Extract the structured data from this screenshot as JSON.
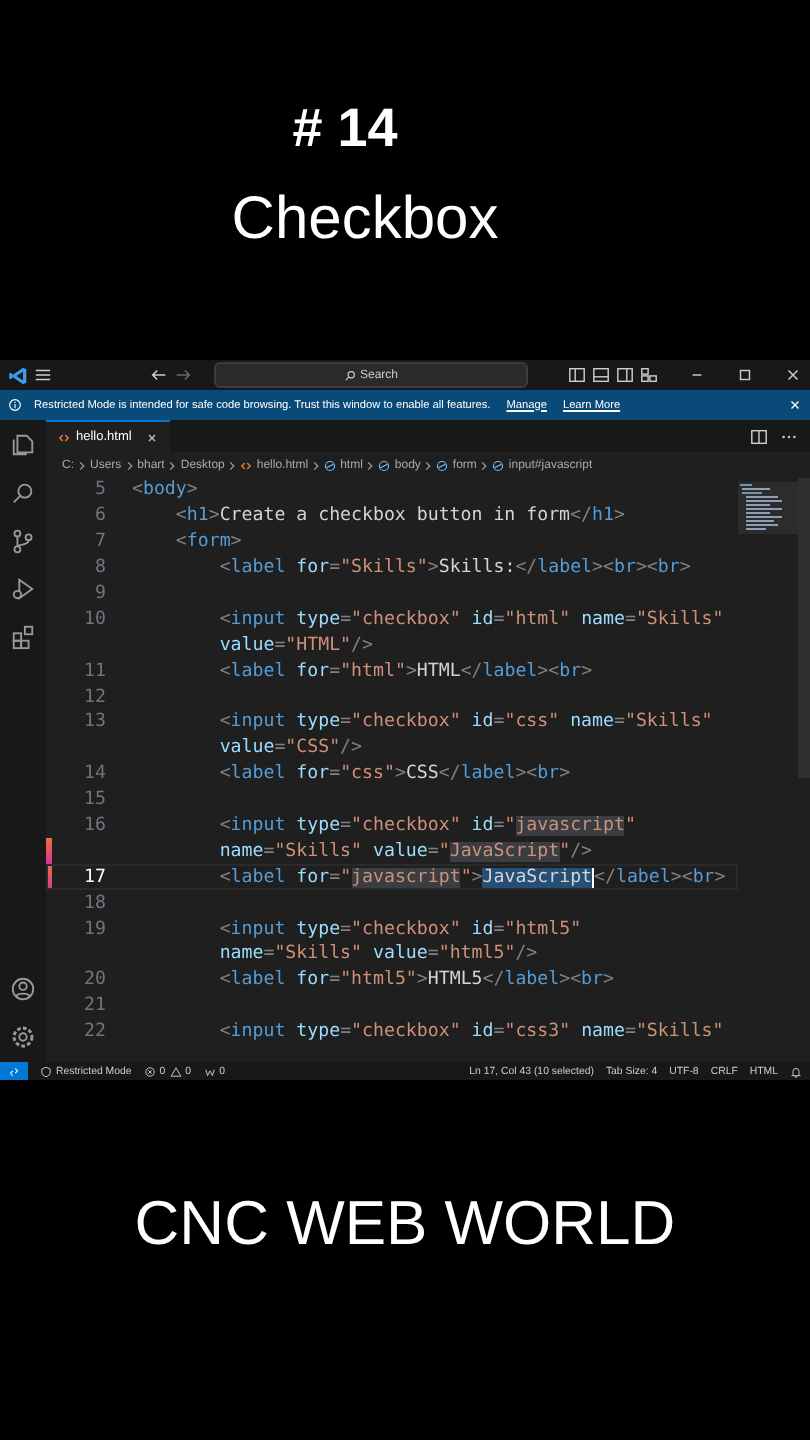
{
  "video_title": {
    "number": "# 14",
    "title": "Checkbox"
  },
  "titlebar": {
    "search": "Search"
  },
  "notification": {
    "text": "Restricted Mode is intended for safe code browsing. Trust this window to enable all features.",
    "links": [
      "Manage",
      "Learn More"
    ]
  },
  "tabs": [
    {
      "label": "hello.html",
      "selected": true
    }
  ],
  "breadcrumbs": [
    {
      "label": "C:",
      "kind": "folder"
    },
    {
      "label": "Users",
      "kind": "folder"
    },
    {
      "label": "bhart",
      "kind": "folder"
    },
    {
      "label": "Desktop",
      "kind": "folder"
    },
    {
      "label": "hello.html",
      "kind": "file"
    },
    {
      "label": "html",
      "kind": "symbol"
    },
    {
      "label": "body",
      "kind": "symbol"
    },
    {
      "label": "form",
      "kind": "symbol"
    },
    {
      "label": "input#javascript",
      "kind": "symbol"
    }
  ],
  "lines": [
    {
      "number": "5",
      "current": false,
      "modified": false,
      "parts": [
        {
          "text": "<body>"
        }
      ]
    },
    {
      "number": "6",
      "current": false,
      "modified": false,
      "parts": [
        {
          "text": "    <h1>Create a checkbox button in form</h1>"
        }
      ]
    },
    {
      "number": "7",
      "current": false,
      "modified": false,
      "parts": [
        {
          "text": "    <form>"
        }
      ]
    },
    {
      "number": "8",
      "current": false,
      "modified": false,
      "parts": [
        {
          "text": "        <label for=\"Skills\">Skills:</label><br><br>"
        }
      ]
    },
    {
      "number": "9",
      "current": false,
      "modified": false
    },
    {
      "number": "10",
      "current": false,
      "modified": false,
      "parts": [
        {
          "text": "        <input type=\"checkbox\" id=\"html\" name=\"Skills\""
        }
      ]
    },
    {
      "modified": false,
      "parts": [
        {
          "text": "        value=\"HTML\"/>"
        }
      ]
    },
    {
      "number": "11",
      "current": false,
      "modified": false,
      "parts": [
        {
          "text": "        <label for=\"html\">HTML</label><br>"
        }
      ]
    },
    {
      "number": "12",
      "current": false,
      "modified": false
    },
    {
      "number": "13",
      "current": false,
      "modified": false,
      "parts": [
        {
          "text": "        <input type=\"checkbox\" id=\"css\" name=\"Skills\""
        }
      ]
    },
    {
      "modified": false,
      "parts": [
        {
          "text": "        value=\"CSS\"/>"
        }
      ]
    },
    {
      "number": "14",
      "current": false,
      "modified": false,
      "parts": [
        {
          "text": "        <label for=\"css\">CSS</label><br>"
        }
      ]
    },
    {
      "number": "15",
      "current": false,
      "modified": false
    },
    {
      "number": "16",
      "current": false,
      "modified": false,
      "parts": [
        {
          "text": "        <input type=\"checkbox\" id=\"",
          "kind": "plain"
        },
        {
          "text": "javascript",
          "kind": "match"
        },
        {
          "text": "\"",
          "kind": "plain"
        }
      ]
    },
    {
      "modified": true,
      "parts": [
        {
          "text": "        name=\"Skills\" value=\"",
          "kind": "plain"
        },
        {
          "text": "JavaScript",
          "kind": "match"
        },
        {
          "text": "\"/>",
          "kind": "plain"
        }
      ]
    },
    {
      "number": "17",
      "current": true,
      "modified": true,
      "parts": [
        {
          "text": "        <label for=\"",
          "kind": "plain"
        },
        {
          "text": "javascript",
          "kind": "match"
        },
        {
          "text": "\">",
          "kind": "plain"
        },
        {
          "text": "JavaScript",
          "kind": "selection"
        },
        {
          "text": "</label><br>",
          "kind": "plain"
        }
      ]
    },
    {
      "number": "18",
      "current": false,
      "modified": false
    },
    {
      "number": "19",
      "current": false,
      "modified": false,
      "parts": [
        {
          "text": "        <input type=\"checkbox\" id=\"html5\""
        }
      ]
    },
    {
      "modified": false,
      "parts": [
        {
          "text": "        name=\"Skills\" value=\"html5\"/>"
        }
      ]
    },
    {
      "number": "20",
      "current": false,
      "modified": false,
      "parts": [
        {
          "text": "        <label for=\"html5\">HTML5</label><br>"
        }
      ]
    },
    {
      "number": "21",
      "current": false,
      "modified": false
    },
    {
      "number": "22",
      "current": false,
      "modified": false,
      "parts": [
        {
          "text": "        <input type=\"checkbox\" id=\"css3\" name=\"Skills\""
        }
      ]
    }
  ],
  "status_bar": {
    "mode": "Restricted Mode",
    "errors": "0",
    "warnings": "0",
    "ports": "0",
    "right": [
      "Ln 17, Col 43 (10 selected)",
      "Tab Size: 4",
      "UTF-8",
      "CRLF",
      "HTML"
    ]
  },
  "footer": "CNC WEB WORLD"
}
